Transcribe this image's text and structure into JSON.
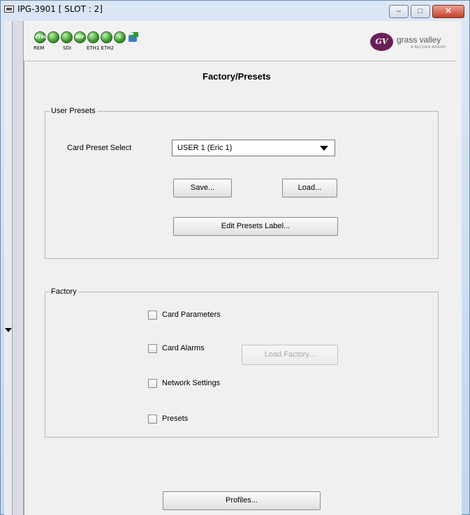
{
  "window": {
    "title": "IPG-3901   [ SLOT : 2]",
    "controls": {
      "minimize": "–",
      "maximize": "□",
      "close": "✕"
    }
  },
  "icons": [
    {
      "name": "ctrl-led-icon",
      "text": "CTRL",
      "label": "REM"
    },
    {
      "name": "status-led-icon",
      "text": "",
      "label": ""
    },
    {
      "name": "sdi-icon",
      "text": "",
      "label": "SDI"
    },
    {
      "name": "ref-led-icon",
      "text": "REF",
      "label": ""
    },
    {
      "name": "eth1-icon",
      "text": "",
      "label": "ETH1"
    },
    {
      "name": "eth2-icon",
      "text": "",
      "label": "ETH2"
    },
    {
      "name": "plus-icon",
      "text": "+",
      "label": ""
    },
    {
      "name": "arrow-icon",
      "text": "",
      "label": ""
    }
  ],
  "icon_labels": {
    "rem": "REM",
    "sdi": "SDI",
    "eth": "ETH1 ETH2",
    "ctrl": "CTRL",
    "ref": "REF"
  },
  "brand": {
    "name": "grass valley",
    "sub": "A BELDEN BRAND",
    "mark": "GV"
  },
  "page": {
    "title": "Factory/Presets"
  },
  "user_presets": {
    "legend": "User Presets",
    "card_preset_label": "Card Preset Select",
    "selected": "USER 1 (Eric 1)",
    "save_label": "Save...",
    "load_label": "Load...",
    "edit_label": "Edit Presets Label..."
  },
  "factory": {
    "legend": "Factory",
    "options": [
      {
        "label": "Card Parameters",
        "checked": false
      },
      {
        "label": "Card Alarms",
        "checked": false
      },
      {
        "label": "Network Settings",
        "checked": false
      },
      {
        "label": "Presets",
        "checked": false
      }
    ],
    "load_factory_label": "Load Factory..."
  },
  "profiles_label": "Profiles..."
}
